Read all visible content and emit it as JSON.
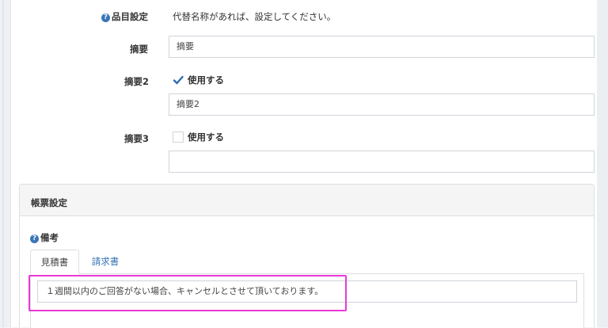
{
  "form": {
    "item_setting": {
      "label": "品目設定",
      "hint": "代替名称があれば、設定してください。"
    },
    "summary": {
      "label": "摘要",
      "value": "摘要"
    },
    "summary2": {
      "label": "摘要2",
      "checkbox_label": "使用する",
      "checked": true,
      "value": "摘要2"
    },
    "summary3": {
      "label": "摘要3",
      "checkbox_label": "使用する",
      "checked": false,
      "value": ""
    }
  },
  "ledger_section": {
    "title": "帳票設定",
    "remarks_label": "備考",
    "tabs": [
      {
        "label": "見積書",
        "active": true
      },
      {
        "label": "請求書",
        "active": false
      }
    ],
    "remark_value": "１週間以内のご回答がない場合、キャンセルとさせて頂いております。"
  },
  "colors": {
    "accent": "#3a76b8",
    "highlight": "#e83ad6",
    "border": "#cfd4da"
  },
  "icons": {
    "help": "question-circle-icon",
    "check": "check-icon"
  }
}
